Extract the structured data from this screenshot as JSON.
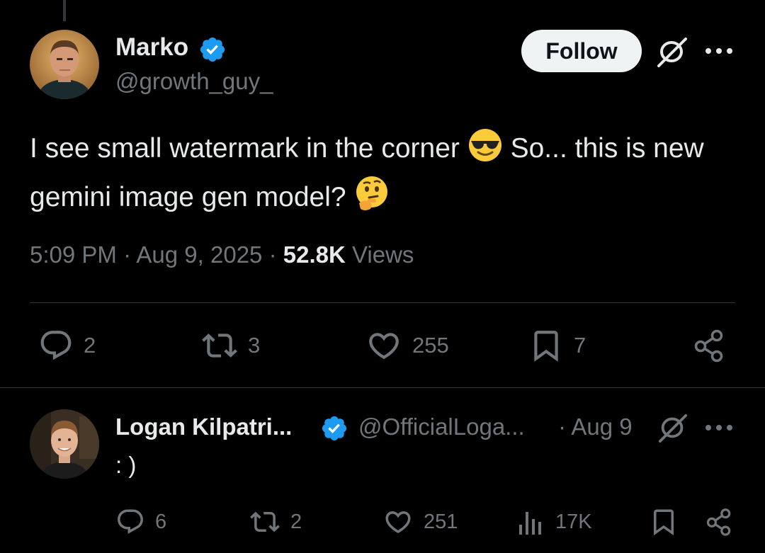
{
  "tweet": {
    "author_name": "Marko",
    "author_handle": "@growth_guy_",
    "follow_label": "Follow",
    "text_part1": "I see small watermark in the corner",
    "text_part2": "So... this is new gemini image gen model?",
    "emoji1": "smiling-face-with-sunglasses",
    "emoji2": "thinking-face",
    "time": "5:09 PM",
    "date": "Aug 9, 2025",
    "views_count": "52.8K",
    "views_label": "Views",
    "stats": {
      "replies": "2",
      "reposts": "3",
      "likes": "255",
      "bookmarks": "7"
    }
  },
  "reply": {
    "author_name": "Logan Kilpatri...",
    "author_handle": "@OfficialLoga...",
    "dot_date": "· Aug 9",
    "text": ": )",
    "stats": {
      "replies": "6",
      "reposts": "2",
      "likes": "251",
      "views": "17K"
    }
  },
  "colors": {
    "background": "#000000",
    "text": "#e7e9ea",
    "muted": "#71767b",
    "verified": "#1d9bf0",
    "divider": "#2f3336"
  }
}
